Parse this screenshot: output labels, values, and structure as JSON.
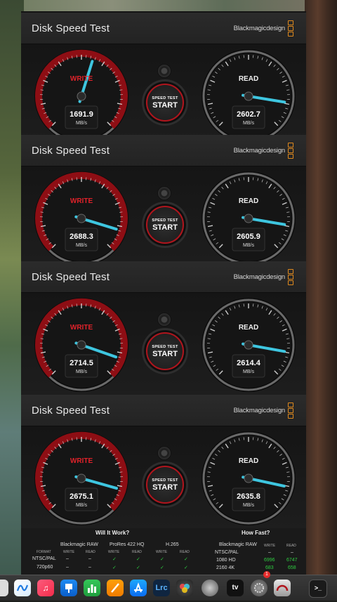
{
  "app": {
    "title": "Disk Speed Test",
    "brand": "Blackmagicdesign",
    "brand_color": "#e08a1e",
    "accent_red": "#b0141c",
    "needle_color": "#3ec6e0"
  },
  "panels": [
    {
      "write_label": "WRITE",
      "write_value": "1691.9",
      "read_label": "READ",
      "read_value": "2602.7",
      "unit": "MB/s",
      "start_small": "SPEED TEST",
      "start_big": "START"
    },
    {
      "write_label": "WRITE",
      "write_value": "2688.3",
      "read_label": "READ",
      "read_value": "2605.9",
      "unit": "MB/s",
      "start_small": "SPEED TEST",
      "start_big": "START"
    },
    {
      "write_label": "WRITE",
      "write_value": "2714.5",
      "read_label": "READ",
      "read_value": "2614.4",
      "unit": "MB/s",
      "start_small": "SPEED TEST",
      "start_big": "START"
    },
    {
      "write_label": "WRITE",
      "write_value": "2675.1",
      "read_label": "READ",
      "read_value": "2635.8",
      "unit": "MB/s",
      "start_small": "SPEED TEST",
      "start_big": "START"
    }
  ],
  "results": {
    "will_it_work": "Will It Work?",
    "how_fast": "How Fast?",
    "col_blackmagic_raw": "Blackmagic RAW",
    "col_prores": "ProRes 422 HQ",
    "col_h265": "H.265",
    "col_format": "FORMAT",
    "col_write": "WRITE",
    "col_read": "READ",
    "row_ntsc": "NTSC/PAL",
    "row_720": "720p60",
    "dash": "–",
    "check": "✓",
    "hf_blackmagic_raw": "Blackmagic RAW",
    "hf_write": "WRITE",
    "hf_read": "READ",
    "hf_rows": [
      {
        "format": "NTSC/PAL",
        "write": "–",
        "read": "–"
      },
      {
        "format": "1080 HD",
        "write": "6996",
        "read": "6747"
      },
      {
        "format": "2160 4K",
        "write": "683",
        "read": "658"
      }
    ]
  },
  "dock": {
    "icons": [
      "freeform-icon",
      "music-icon",
      "keynote-icon",
      "numbers-icon",
      "pages-icon",
      "app-store-icon",
      "lightroom-classic-icon",
      "davinci-resolve-icon",
      "safari-icon",
      "apple-tv-icon",
      "system-settings-icon",
      "blackmagic-disk-speed-icon",
      "terminal-icon"
    ],
    "lrc_label": "Lrc",
    "tv_label": "tv",
    "badge": "1"
  }
}
